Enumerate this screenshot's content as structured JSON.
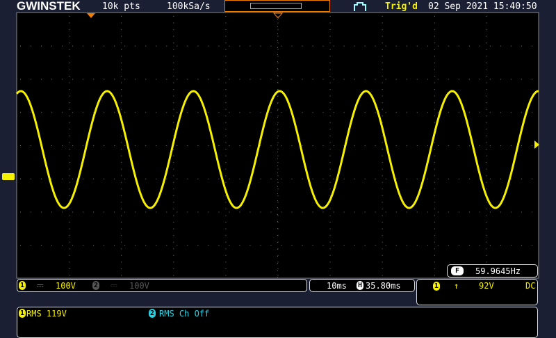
{
  "header": {
    "brand": "GWINSTEK",
    "record_length": "10k pts",
    "sample_rate": "100kSa/s",
    "trigger_status": "Trig'd",
    "datetime": "02 Sep 2021 15:40:50"
  },
  "waveform": {
    "channel": "1",
    "color": "#f5f000",
    "frequency_hz": 59.9645,
    "cycles_visible": 6
  },
  "frequency": {
    "icon": "F",
    "value": "59.9645Hz"
  },
  "channels": [
    {
      "num": "1",
      "coupling_icon": "dc-coupling-icon",
      "scale": "100V",
      "color": "#f5f000"
    },
    {
      "num": "2",
      "coupling_icon": "dc-coupling-icon",
      "scale": "100V",
      "color": "#555555"
    }
  ],
  "timebase": {
    "scale": "10ms",
    "h_icon": "H",
    "position": "35.80ms"
  },
  "trigger": {
    "source": "1",
    "slope_icon": "rising-edge-icon",
    "level": "92V",
    "coupling": "DC"
  },
  "measurements": [
    {
      "num": "1",
      "text": "RMS 119V",
      "color": "#f5f000"
    },
    {
      "num": "2",
      "text": "RMS Ch Off",
      "color": "#22d3e6"
    }
  ]
}
